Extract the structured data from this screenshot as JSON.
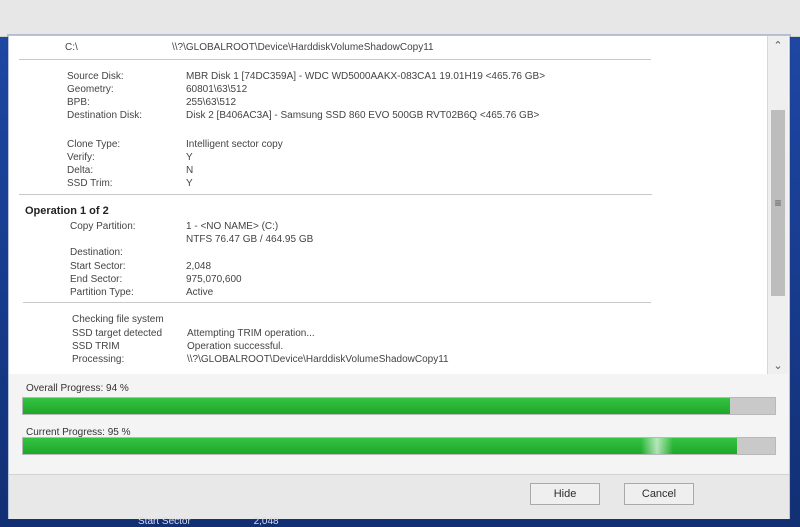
{
  "dialog": {
    "log": {
      "header": {
        "path_label": "C:\\",
        "path_value": "\\\\?\\GLOBALROOT\\Device\\HarddiskVolumeShadowCopy11"
      },
      "summary_rows": [
        {
          "label": "Source Disk:",
          "value": "MBR Disk 1 [74DC359A] - WDC WD5000AAKX-083CA1 19.01H19  <465.76 GB>"
        },
        {
          "label": "Geometry:",
          "value": "60801\\63\\512"
        },
        {
          "label": "BPB:",
          "value": "255\\63\\512"
        },
        {
          "label": "Destination Disk:",
          "value": "Disk 2 [B406AC3A] - Samsung SSD 860 EVO 500GB RVT02B6Q  <465.76 GB>"
        },
        {
          "label": "Clone Type:",
          "value": "Intelligent sector copy"
        },
        {
          "label": "Verify:",
          "value": "Y"
        },
        {
          "label": "Delta:",
          "value": "N"
        },
        {
          "label": "SSD Trim:",
          "value": "Y"
        }
      ],
      "operation_title": "Operation 1 of 2",
      "operation_rows": [
        {
          "label": "Copy Partition:",
          "value": "1 - <NO NAME> (C:)"
        },
        {
          "label": "",
          "value": "NTFS 76.47 GB / 464.95 GB"
        },
        {
          "label": "Destination:",
          "value": ""
        },
        {
          "label": "Start Sector:",
          "value": "2,048"
        },
        {
          "label": "End Sector:",
          "value": "975,070,600"
        },
        {
          "label": "Partition Type:",
          "value": "Active"
        }
      ],
      "status_rows": [
        {
          "label": "Checking file system",
          "value": ""
        },
        {
          "label": "SSD target detected",
          "value": "Attempting TRIM operation..."
        },
        {
          "label": "SSD TRIM",
          "value": "Operation successful."
        },
        {
          "label": "Processing:",
          "value": "\\\\?\\GLOBALROOT\\Device\\HarddiskVolumeShadowCopy11"
        }
      ]
    },
    "progress": {
      "overall": {
        "label": "Overall Progress:",
        "value_text": "94 %",
        "percent": 94
      },
      "current": {
        "label": "Current Progress:",
        "value_text": "95 %",
        "percent": 95
      }
    },
    "buttons": {
      "hide": "Hide",
      "cancel": "Cancel"
    },
    "background_peek": {
      "label": "Start Sector",
      "value": "2,048"
    },
    "icons": {
      "scroll_up": "chevron-up-icon",
      "scroll_down": "chevron-down-icon",
      "scroll_grip": "menu-icon"
    }
  }
}
